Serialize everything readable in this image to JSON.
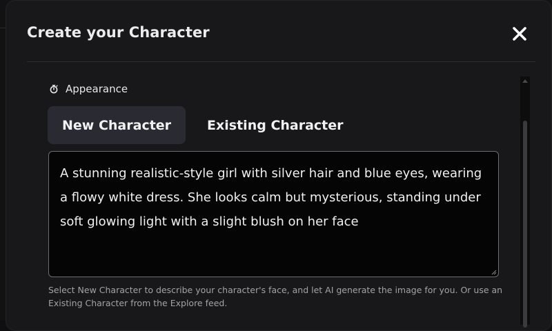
{
  "modal": {
    "title": "Create your Character",
    "close_icon": "close-icon"
  },
  "appearance": {
    "label": "Appearance",
    "icon": "timer-icon"
  },
  "tabs": [
    {
      "label": "New Character",
      "active": true
    },
    {
      "label": "Existing Character",
      "active": false
    }
  ],
  "description": {
    "value": "A stunning realistic-style girl with silver hair and blue eyes, wearing a flowy white dress. She looks calm but mysterious, standing under soft glowing light with a slight blush on her face"
  },
  "helper_text": "Select New Character to describe your character's face, and let AI generate the image for you. Or use an Existing Character from the Explore feed.",
  "colors": {
    "modal_bg": "#18181a",
    "tab_active_bg": "#2a2a32",
    "textarea_bg": "#050505",
    "textarea_border": "#6b6e74",
    "helper_text": "#a3a3a6"
  }
}
